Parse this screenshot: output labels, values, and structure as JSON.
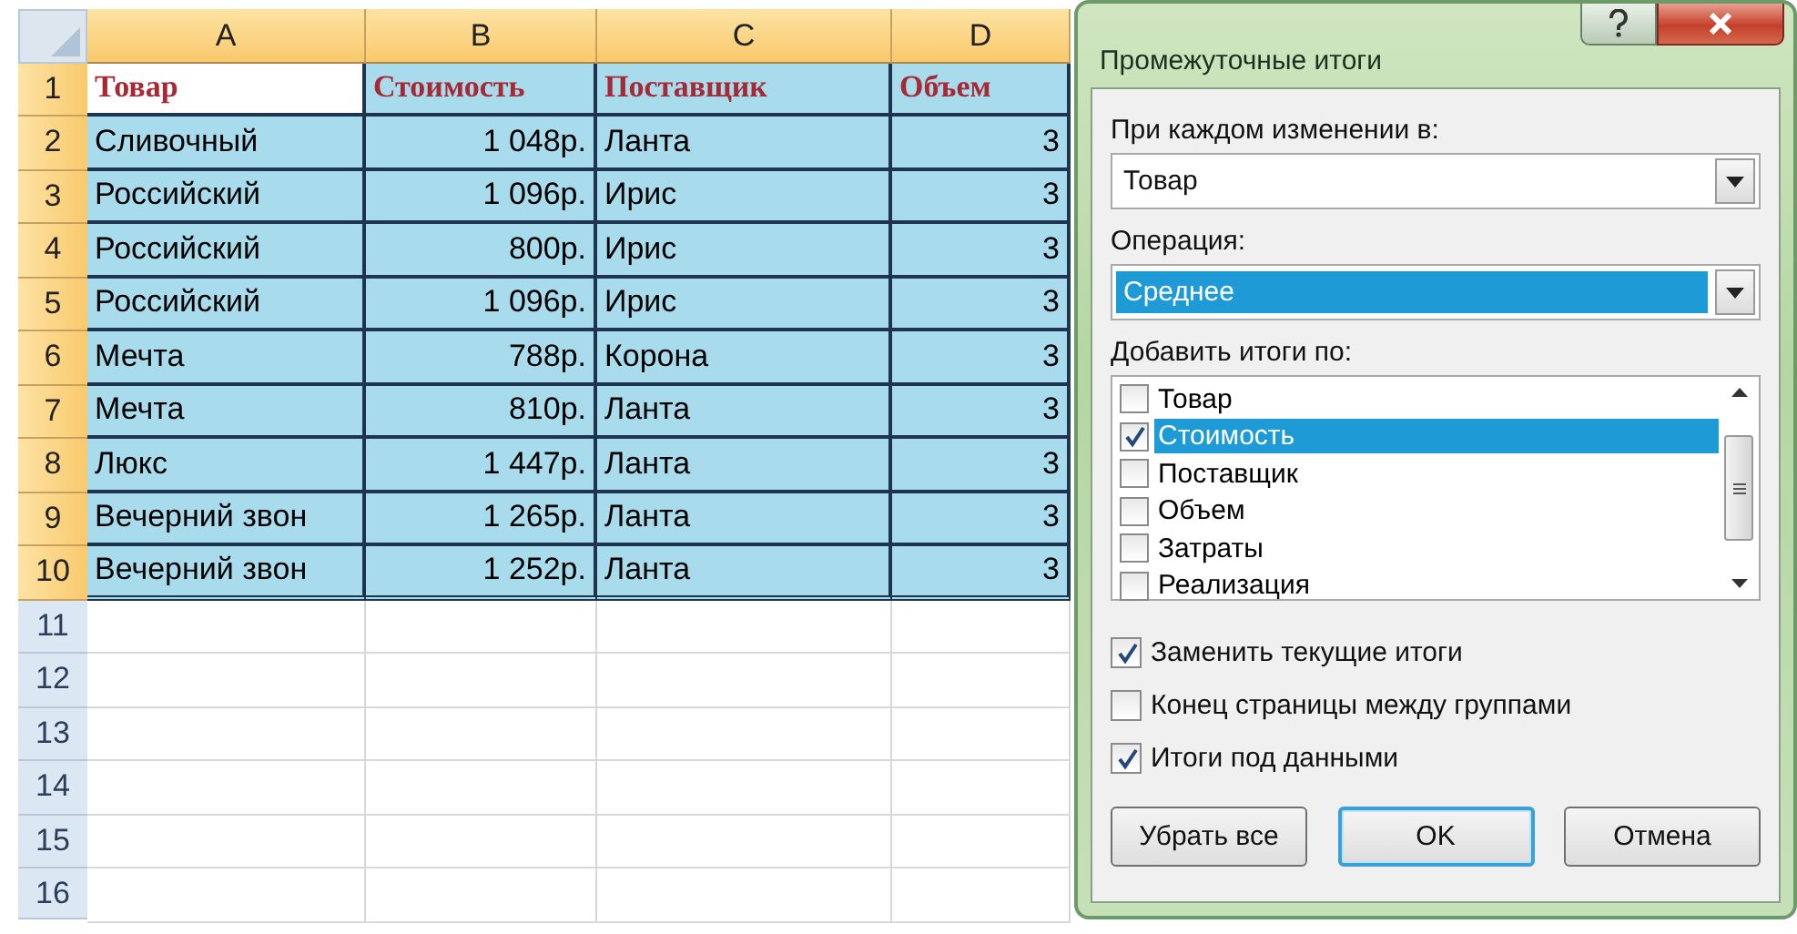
{
  "sheet": {
    "columns": [
      {
        "label": "A",
        "selected": true
      },
      {
        "label": "B",
        "selected": true
      },
      {
        "label": "C",
        "selected": true
      },
      {
        "label": "D",
        "selected": true
      }
    ],
    "rows": [
      {
        "number": "1",
        "selected": true,
        "kind": "header",
        "cells": [
          {
            "text": "Товар",
            "active": true
          },
          {
            "text": "Стоимость",
            "active": false
          },
          {
            "text": "Поставщик",
            "active": false
          },
          {
            "text": "Объем",
            "active": false
          }
        ]
      },
      {
        "number": "2",
        "selected": true,
        "kind": "data",
        "cells": [
          {
            "text": "Сливочный",
            "active": false
          },
          {
            "text": "1 048р.",
            "active": false
          },
          {
            "text": "Ланта",
            "active": false
          },
          {
            "text": "3",
            "active": false
          }
        ]
      },
      {
        "number": "3",
        "selected": true,
        "kind": "data",
        "cells": [
          {
            "text": "Российский",
            "active": false
          },
          {
            "text": "1 096р.",
            "active": false
          },
          {
            "text": "Ирис",
            "active": false
          },
          {
            "text": "3",
            "active": false
          }
        ]
      },
      {
        "number": "4",
        "selected": true,
        "kind": "data",
        "cells": [
          {
            "text": "Российский",
            "active": false
          },
          {
            "text": "800р.",
            "active": false
          },
          {
            "text": "Ирис",
            "active": false
          },
          {
            "text": "3",
            "active": false
          }
        ]
      },
      {
        "number": "5",
        "selected": true,
        "kind": "data",
        "cells": [
          {
            "text": "Российский",
            "active": false
          },
          {
            "text": "1 096р.",
            "active": false
          },
          {
            "text": "Ирис",
            "active": false
          },
          {
            "text": "3",
            "active": false
          }
        ]
      },
      {
        "number": "6",
        "selected": true,
        "kind": "data",
        "cells": [
          {
            "text": "Мечта",
            "active": false
          },
          {
            "text": "788р.",
            "active": false
          },
          {
            "text": "Корона",
            "active": false
          },
          {
            "text": "3",
            "active": false
          }
        ]
      },
      {
        "number": "7",
        "selected": true,
        "kind": "data",
        "cells": [
          {
            "text": "Мечта",
            "active": false
          },
          {
            "text": "810р.",
            "active": false
          },
          {
            "text": "Ланта",
            "active": false
          },
          {
            "text": "3",
            "active": false
          }
        ]
      },
      {
        "number": "8",
        "selected": true,
        "kind": "data",
        "cells": [
          {
            "text": "Люкс",
            "active": false
          },
          {
            "text": "1 447р.",
            "active": false
          },
          {
            "text": "Ланта",
            "active": false
          },
          {
            "text": "3",
            "active": false
          }
        ]
      },
      {
        "number": "9",
        "selected": true,
        "kind": "data",
        "cells": [
          {
            "text": "Вечерний звон",
            "active": false
          },
          {
            "text": "1 265р.",
            "active": false
          },
          {
            "text": "Ланта",
            "active": false
          },
          {
            "text": "3",
            "active": false
          }
        ]
      },
      {
        "number": "10",
        "selected": true,
        "kind": "data",
        "cells": [
          {
            "text": "Вечерний звон",
            "active": false
          },
          {
            "text": "1 252р.",
            "active": false
          },
          {
            "text": "Ланта",
            "active": false
          },
          {
            "text": "3",
            "active": false
          }
        ]
      },
      {
        "number": "11",
        "selected": false,
        "kind": "data"
      },
      {
        "number": "12",
        "selected": false,
        "kind": "data"
      },
      {
        "number": "13",
        "selected": false,
        "kind": "data"
      },
      {
        "number": "14",
        "selected": false,
        "kind": "data"
      },
      {
        "number": "15",
        "selected": false,
        "kind": "data"
      },
      {
        "number": "16",
        "selected": false,
        "kind": "data"
      }
    ]
  },
  "dialog": {
    "title": "Промежуточные итоги",
    "group_by": {
      "label": "При каждом изменении в:",
      "value": "Товар",
      "highlighted": false
    },
    "operation": {
      "label": "Операция:",
      "value": "Среднее",
      "highlighted": true
    },
    "add_totals": {
      "label": "Добавить итоги по:",
      "items": [
        {
          "label": "Товар",
          "checked": false,
          "selected": false
        },
        {
          "label": "Стоимость",
          "checked": true,
          "selected": true
        },
        {
          "label": "Поставщик",
          "checked": false,
          "selected": false
        },
        {
          "label": "Объем",
          "checked": false,
          "selected": false
        },
        {
          "label": " Затраты",
          "checked": false,
          "selected": false
        },
        {
          "label": "Реализация",
          "checked": false,
          "selected": false
        }
      ]
    },
    "options": [
      {
        "label": "Заменить текущие итоги",
        "checked": true
      },
      {
        "label": "Конец страницы между группами",
        "checked": false
      },
      {
        "label": "Итоги под данными",
        "checked": true
      }
    ],
    "buttons": [
      {
        "label": "Убрать все",
        "default": false
      },
      {
        "label": "OK",
        "default": true
      },
      {
        "label": "Отмена",
        "default": false
      }
    ]
  }
}
